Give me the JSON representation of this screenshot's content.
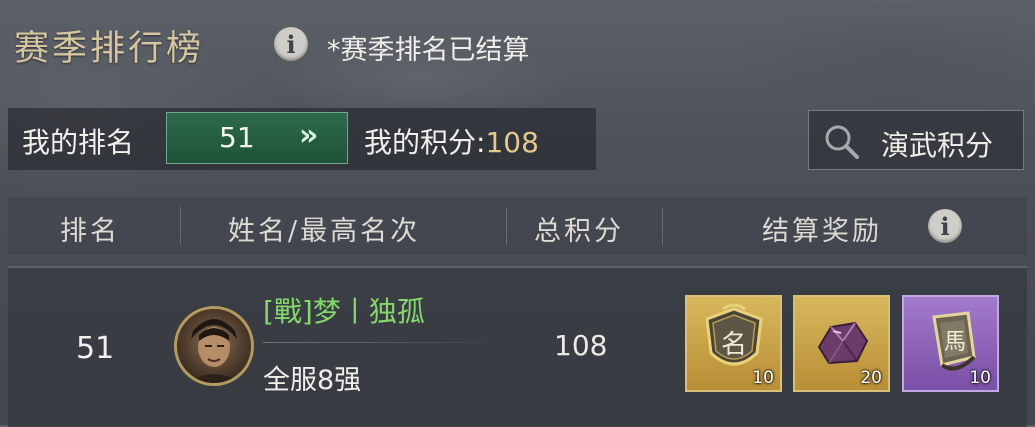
{
  "header": {
    "title": "赛季排行榜",
    "season_note": "*赛季排名已结算"
  },
  "my_panel": {
    "rank_label": "我的排名",
    "rank_value": "51",
    "rank_arrow": "»",
    "score_label": "我的积分:",
    "score_value": "108"
  },
  "search_button": {
    "label": "演武积分",
    "icon": "magnifier-icon"
  },
  "table": {
    "columns": [
      "排名",
      "姓名/最高名次",
      "总积分",
      "结算奖励"
    ],
    "rows": [
      {
        "rank": "51",
        "name": "[戰]梦丨独孤",
        "best_rank": "全服8强",
        "score": "108",
        "rewards": [
          {
            "icon": "name-shield-icon",
            "glyph": "名",
            "count": "10",
            "rarity": "gold"
          },
          {
            "icon": "purple-ore-icon",
            "count": "20",
            "rarity": "gold"
          },
          {
            "icon": "horse-token-icon",
            "glyph": "馬",
            "count": "10",
            "rarity": "purple"
          }
        ]
      }
    ]
  },
  "colors": {
    "title": "#d6c6a0",
    "rank_box": "#2d6a4d",
    "player_name": "#84d86a",
    "score_value": "#e3c98a",
    "reward_gold": "#c9a247",
    "reward_purple": "#8e64b9"
  }
}
